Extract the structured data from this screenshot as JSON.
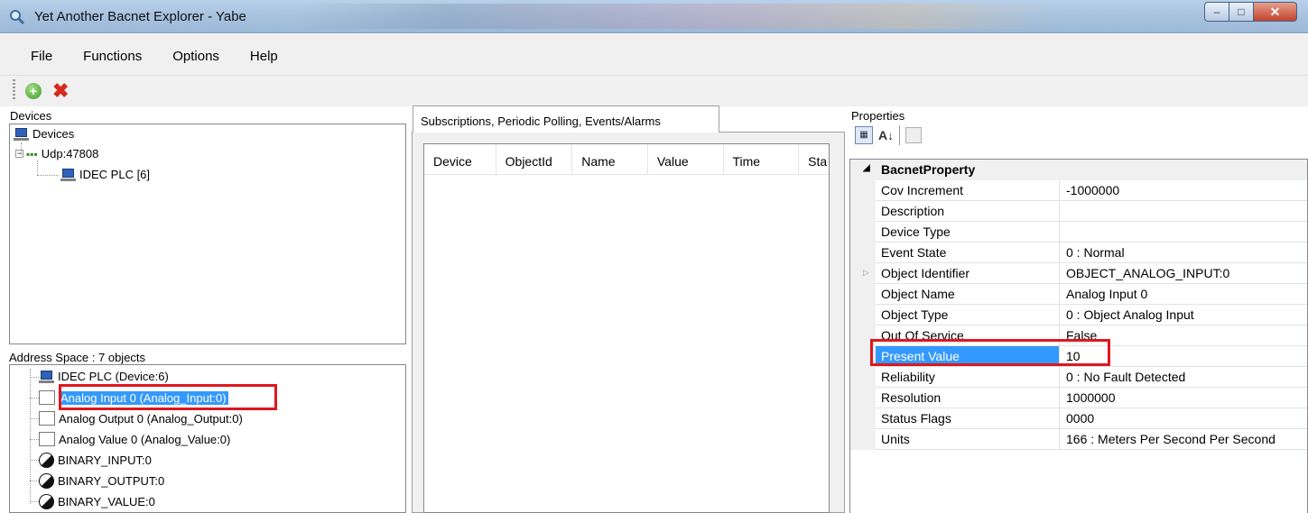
{
  "window": {
    "title": "Yet Another Bacnet Explorer - Yabe",
    "min": "–",
    "max": "□",
    "close": "✕"
  },
  "menu": [
    "File",
    "Functions",
    "Options",
    "Help"
  ],
  "toolbar": {
    "add_icon": "+",
    "delete_icon": "✖"
  },
  "devices": {
    "label": "Devices",
    "root": "Devices",
    "network": "Udp:47808",
    "device": "IDEC PLC [6]"
  },
  "address_space": {
    "label": "Address Space : 7 objects",
    "items": [
      {
        "label": "IDEC PLC (Device:6)",
        "icon": "computer-icon"
      },
      {
        "label": "Analog Input 0 (Analog_Input:0)",
        "icon": "analog-icon",
        "selected": true
      },
      {
        "label": "Analog Output 0 (Analog_Output:0)",
        "icon": "analog-icon"
      },
      {
        "label": "Analog Value 0 (Analog_Value:0)",
        "icon": "analog-icon"
      },
      {
        "label": "BINARY_INPUT:0",
        "icon": "binary-icon"
      },
      {
        "label": "BINARY_OUTPUT:0",
        "icon": "binary-icon"
      },
      {
        "label": "BINARY_VALUE:0",
        "icon": "binary-icon"
      }
    ]
  },
  "subscriptions": {
    "tab": "Subscriptions, Periodic Polling, Events/Alarms",
    "columns": [
      "Device",
      "ObjectId",
      "Name",
      "Value",
      "Time",
      "Sta"
    ]
  },
  "properties": {
    "label": "Properties",
    "category": "BacnetProperty",
    "rows": [
      {
        "name": "Cov Increment",
        "value": "-1000000"
      },
      {
        "name": "Description",
        "value": ""
      },
      {
        "name": "Device Type",
        "value": ""
      },
      {
        "name": "Event State",
        "value": "0 : Normal"
      },
      {
        "name": "Object Identifier",
        "value": "OBJECT_ANALOG_INPUT:0"
      },
      {
        "name": "Object Name",
        "value": "Analog Input 0"
      },
      {
        "name": "Object Type",
        "value": "0 : Object Analog Input"
      },
      {
        "name": "Out Of Service",
        "value": "False"
      },
      {
        "name": "Present Value",
        "value": "10",
        "selected": true
      },
      {
        "name": "Reliability",
        "value": "0 : No Fault Detected"
      },
      {
        "name": "Resolution",
        "value": "1000000"
      },
      {
        "name": "Status Flags",
        "value": "0000"
      },
      {
        "name": "Units",
        "value": "166 : Meters Per Second Per Second"
      }
    ]
  }
}
